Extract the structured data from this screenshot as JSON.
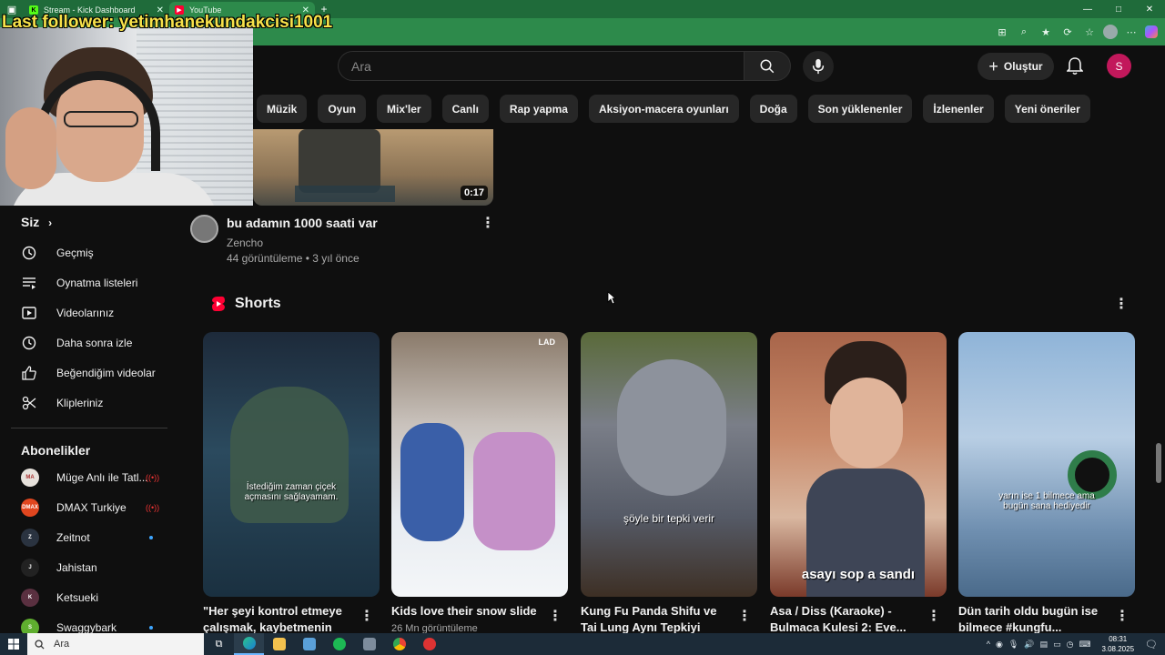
{
  "browser": {
    "tabs": [
      {
        "title": "Stream - Kick Dashboard",
        "fav_text": "K",
        "fav_color": "#53fc18"
      },
      {
        "title": "YouTube",
        "fav_text": "▶",
        "fav_color": "#ff0033"
      }
    ],
    "new_tab": "+",
    "win_min": "—",
    "win_max": "□",
    "win_close": "✕"
  },
  "youtube": {
    "search_placeholder": "Ara",
    "create_label": "Oluştur",
    "avatar_letter": "S",
    "chips": [
      "Müzik",
      "Oyun",
      "Mix'ler",
      "Canlı",
      "Rap yapma",
      "Aksiyon-macera oyunları",
      "Doğa",
      "Son yüklenenler",
      "İzlenenler",
      "Yeni öneriler"
    ]
  },
  "overlay": {
    "follower_text": "Last follower: yetimhanekundakcisi1001"
  },
  "video": {
    "duration": "0:17",
    "title": "bu adamın 1000 saati var",
    "channel": "Zencho",
    "stats": "44 görüntüleme • 3 yıl önce"
  },
  "sidebar": {
    "you_label": "Siz",
    "items": [
      {
        "label": "Geçmiş",
        "icon": "history-icon"
      },
      {
        "label": "Oynatma listeleri",
        "icon": "playlist-icon"
      },
      {
        "label": "Videolarınız",
        "icon": "your-videos-icon"
      },
      {
        "label": "Daha sonra izle",
        "icon": "watch-later-icon"
      },
      {
        "label": "Beğendiğim videolar",
        "icon": "like-icon"
      },
      {
        "label": "Klipleriniz",
        "icon": "clips-icon"
      }
    ],
    "subs_label": "Abonelikler",
    "subscriptions": [
      {
        "name": "Müge Anlı ile Tatl...",
        "badge": "live",
        "color": "#e7e2dc",
        "initials": "MA"
      },
      {
        "name": "DMAX Turkiye",
        "badge": "live",
        "color": "#e0461f",
        "initials": "DMAX"
      },
      {
        "name": "Zeitnot",
        "badge": "dot",
        "color": "#2a3340",
        "initials": "Z"
      },
      {
        "name": "Jahistan",
        "badge": "",
        "color": "#222222",
        "initials": "J"
      },
      {
        "name": "Ketsueki",
        "badge": "",
        "color": "#5a3040",
        "initials": "K"
      },
      {
        "name": "Swaggybark",
        "badge": "dot",
        "color": "#5fae2f",
        "initials": "S"
      }
    ]
  },
  "shorts": {
    "heading": "Shorts",
    "items": [
      {
        "title": "\"Her şeyi kontrol etmeye çalışmak, kaybetmenin en...",
        "sub": "",
        "caption": "İstediğim zaman çiçek açmasını sağlayamam.",
        "bg": "linear-gradient(180deg,#1d2a3a 0%,#2b4a5e 45%,#1a3040 100%)"
      },
      {
        "title": "Kids love their snow slide",
        "sub": "26 Mn görüntüleme",
        "caption": "",
        "bg": "linear-gradient(180deg,#8a7a6a 0%,#c9c2bc 35%,#e8ecf1 70%,#f4f6f8 100%)"
      },
      {
        "title": "Kung Fu Panda Shifu ve Tai Lung Aynı Tepkiyi Veriyor",
        "sub": "",
        "caption": "şöyle bir tepki verir",
        "bg": "linear-gradient(180deg,#5a6a3a 0%,#7a7e88 35%,#555a66 70%,#3d2f24 100%)"
      },
      {
        "title": "Asa / Diss (Karaoke) - Bulmaca Kulesi 2: Eve...",
        "sub": "",
        "caption": "asayı sop a sandı",
        "bg": "linear-gradient(180deg,#a8654a 0%,#c98a6a 40%,#d9b7a0 70%,#7a3a2a 100%)"
      },
      {
        "title": "Dün tarih oldu bugün ise bilmece #kungfu...",
        "sub": "",
        "caption": "yarın ise 1 bilmece ama bugün sana hediyedir",
        "bg": "linear-gradient(180deg,#8fb4d8 0%,#b8cee4 40%,#6f8fb0 75%,#4a6a8a 100%)"
      }
    ]
  },
  "taskbar": {
    "search_text": "Ara",
    "time": "08:31",
    "date": "3.08.2025"
  }
}
